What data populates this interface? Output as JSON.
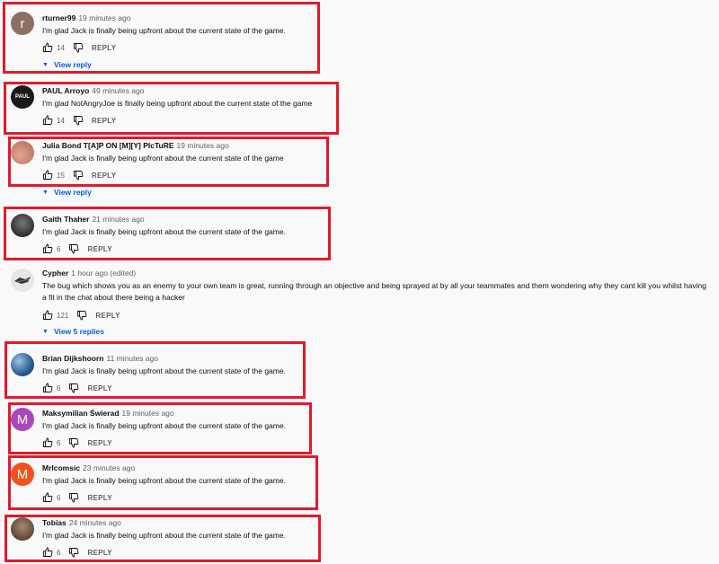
{
  "comments": [
    {
      "author": "rturner99",
      "time": "19 minutes ago",
      "text": "I'm glad Jack is finally being upfront about the current state of the game.",
      "likes": "14",
      "reply_label": "REPLY",
      "avatar_letter": "r",
      "avatar_color": "#8d6e63",
      "view_replies": "View reply"
    },
    {
      "author": "PAUL Arroyo",
      "time": "49 minutes ago",
      "text": "I'm glad NotAngryJoe is finally being upfront about the current state of the game",
      "likes": "14",
      "reply_label": "REPLY",
      "avatar_letter": "",
      "avatar_color": "#1a1a1a",
      "avatar_text": "PAUL"
    },
    {
      "author": "Julia Bond T[A]P ON [M][Y] PIcTuRE",
      "time": "19 minutes ago",
      "text": "I'm glad Jack is finally being upfront about the current state of the game",
      "likes": "15",
      "reply_label": "REPLY",
      "avatar_letter": "",
      "avatar_color": "#c97a6a",
      "view_replies": "View reply"
    },
    {
      "author": "Gaith Thaher",
      "time": "21 minutes ago",
      "text": "I'm glad Jack is finally being upfront about the current state of the game.",
      "likes": "6",
      "reply_label": "REPLY",
      "avatar_letter": "",
      "avatar_color": "#2a2a2a"
    },
    {
      "author": "Cypher",
      "time": "1 hour ago (edited)",
      "text": "The bug which shows you as an enemy to your own team is great, running through an objective and being sprayed at by all your teammates and them wondering why they cant kill you whilst having a fit in the chat about there being a hacker",
      "likes": "121",
      "reply_label": "REPLY",
      "avatar_letter": "",
      "avatar_color": "#e8e8e8",
      "view_replies": "View 5 replies"
    },
    {
      "author": "Brian Dijkshoorn",
      "time": "11 minutes ago",
      "text": "I'm glad Jack is finally being upfront about the current state of the game.",
      "likes": "6",
      "reply_label": "REPLY",
      "avatar_letter": "",
      "avatar_color": "#3b6ea5"
    },
    {
      "author": "Maksymilian Świerad",
      "time": "19 minutes ago",
      "text": "I'm glad Jack is finally being upfront about the current state of the game.",
      "likes": "6",
      "reply_label": "REPLY",
      "avatar_letter": "M",
      "avatar_color": "#ab47bc"
    },
    {
      "author": "MrIcomsic",
      "time": "23 minutes ago",
      "text": "I'm glad Jack is finally being upfront about the current state of the game.",
      "likes": "6",
      "reply_label": "REPLY",
      "avatar_letter": "M",
      "avatar_color": "#f4511e"
    },
    {
      "author": "Tobias",
      "time": "24 minutes ago",
      "text": "I'm glad Jack is finally being upfront about the current state of the game.",
      "likes": "6",
      "reply_label": "REPLY",
      "avatar_letter": "",
      "avatar_color": "#5d4037"
    }
  ],
  "highlight_color": "#e01b2b",
  "link_color": "#065fd4"
}
